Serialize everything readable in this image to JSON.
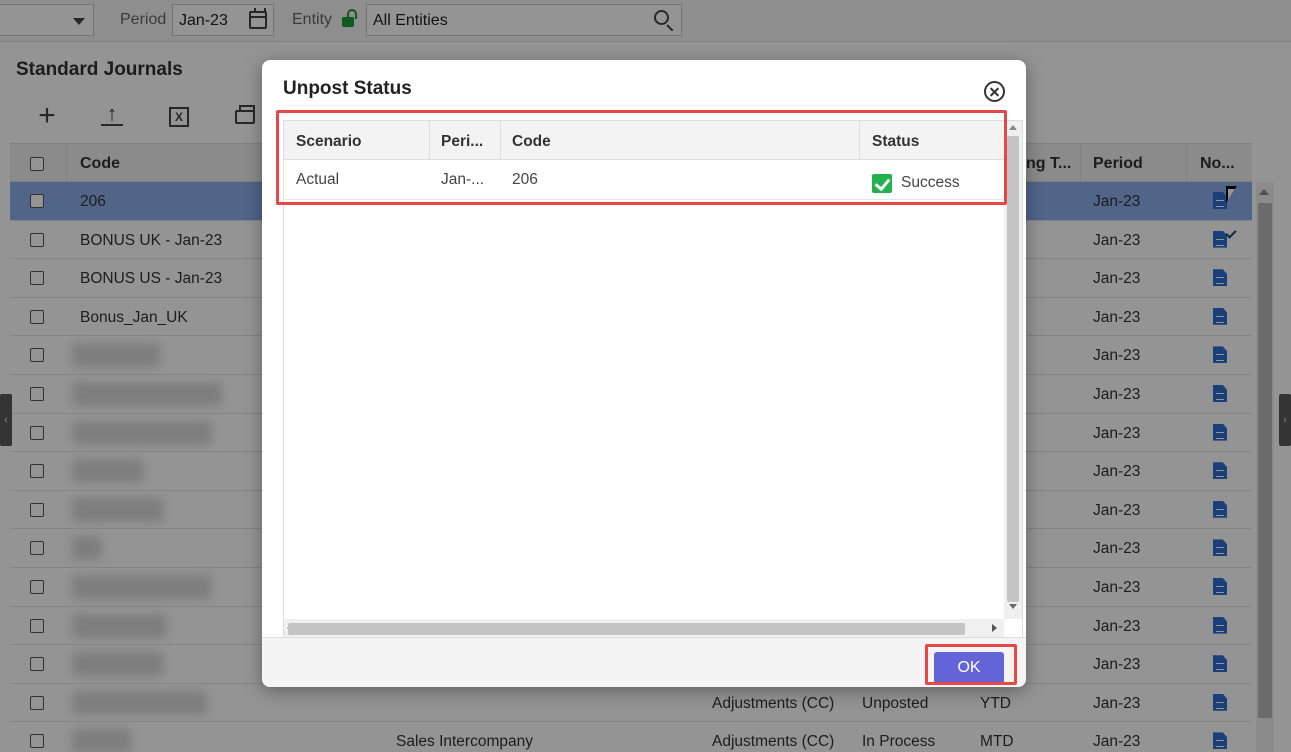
{
  "topbar": {
    "period_label": "Period",
    "period_value": "Jan-23",
    "entity_label": "Entity",
    "entity_value": "All Entities"
  },
  "page": {
    "title": "Standard Journals"
  },
  "grid": {
    "columns": {
      "code": "Code",
      "posting_type": "ng T...",
      "period": "Period",
      "notes": "No..."
    },
    "rows": [
      {
        "code": "206",
        "period": "Jan-23",
        "selected": true
      },
      {
        "code": "BONUS UK - Jan-23",
        "period": "Jan-23"
      },
      {
        "code": "BONUS US - Jan-23",
        "period": "Jan-23"
      },
      {
        "code": "Bonus_Jan_UK",
        "period": "Jan-23"
      },
      {
        "code": "",
        "period": "Jan-23"
      },
      {
        "code": "",
        "period": "Jan-23"
      },
      {
        "code": "",
        "period": "Jan-23"
      },
      {
        "code": "",
        "period": "Jan-23"
      },
      {
        "code": "",
        "period": "Jan-23"
      },
      {
        "code": "",
        "period": "Jan-23"
      },
      {
        "code": "",
        "period": "Jan-23"
      },
      {
        "code": "",
        "period": "Jan-23"
      },
      {
        "code": "",
        "period": "Jan-23"
      },
      {
        "code": "",
        "desc": "",
        "type": "Adjustments (CC)",
        "status": "Unposted",
        "freq": "YTD",
        "period": "Jan-23"
      },
      {
        "code": "",
        "desc": "Sales Intercompany",
        "type": "Adjustments (CC)",
        "status": "In Process",
        "freq": "MTD",
        "period": "Jan-23"
      }
    ]
  },
  "modal": {
    "title": "Unpost Status",
    "columns": {
      "scenario": "Scenario",
      "period": "Peri...",
      "code": "Code",
      "status": "Status"
    },
    "row": {
      "scenario": "Actual",
      "period": "Jan-...",
      "code": "206",
      "status": "Success"
    },
    "ok_label": "OK"
  },
  "colors": {
    "accent": "#6464d8",
    "highlight": "#e84747",
    "success": "#22b24c",
    "selected_row": "#8aaeea",
    "unlock": "#1d9a3a"
  }
}
